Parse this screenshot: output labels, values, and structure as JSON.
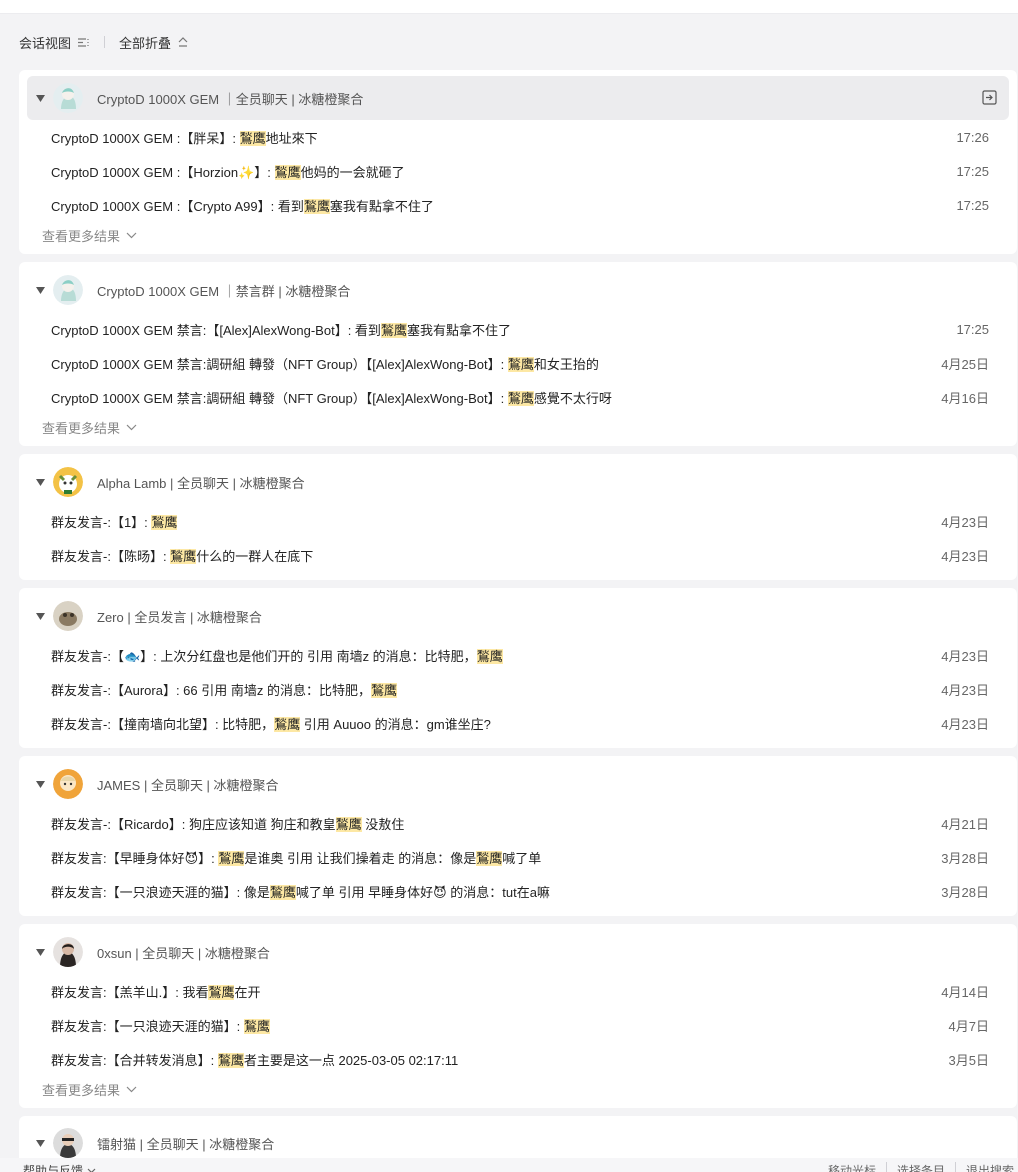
{
  "toolbar": {
    "view_label": "会话视图",
    "collapse_label": "全部折叠"
  },
  "groups": [
    {
      "title": "CryptoD 1000X GEM ｜全员聊天 | 冰糖橙聚合",
      "more_label": "查看更多结果",
      "messages": [
        {
          "pre": "CryptoD 1000X GEM :【胖呆】: ",
          "hl": "鶖鹰",
          "post": "地址來下",
          "time": "17:26"
        },
        {
          "pre": "CryptoD 1000X GEM :【Horzion✨】: ",
          "hl": "鶖鹰",
          "post": "他妈的一会就砸了",
          "time": "17:25"
        },
        {
          "pre": "CryptoD 1000X GEM :【Crypto A99】: 看到",
          "hl": "鶖鹰",
          "post": "塞我有點拿不住了",
          "time": "17:25"
        }
      ]
    },
    {
      "title": "CryptoD 1000X GEM ｜禁言群 | 冰糖橙聚合",
      "more_label": "查看更多结果",
      "messages": [
        {
          "pre": "CryptoD 1000X GEM 禁言:【[Alex]AlexWong-Bot】: 看到",
          "hl": "鶖鹰",
          "post": "塞我有點拿不住了",
          "time": "17:25"
        },
        {
          "pre": "CryptoD 1000X GEM 禁言:調研組 轉發（NFT Group）【[Alex]AlexWong-Bot】: ",
          "hl": "鶖鹰",
          "post": "和女王抬的",
          "time": "4月25日"
        },
        {
          "pre": "CryptoD 1000X GEM 禁言:調研組 轉發（NFT Group）【[Alex]AlexWong-Bot】: ",
          "hl": "鶖鹰",
          "post": "感覺不太行呀",
          "time": "4月16日"
        }
      ]
    },
    {
      "title": "Alpha Lamb | 全员聊天 | 冰糖橙聚合",
      "messages": [
        {
          "pre": "群友发言-:【1】:  ",
          "hl": "鶖鹰",
          "post": "",
          "time": "4月23日"
        },
        {
          "pre": "群友发言-:【陈旸】:  ",
          "hl": "鶖鹰",
          "post": "什么的一群人在底下",
          "time": "4月23日"
        }
      ]
    },
    {
      "title": "Zero | 全员发言 | 冰糖橙聚合",
      "messages": [
        {
          "pre": "群友发言-:【🐟】:  上次分红盘也是他们开的 引用 南墙z 的消息：比特肥，",
          "hl": "鶖鹰",
          "post": "",
          "time": "4月23日"
        },
        {
          "pre": "群友发言-:【Aurora】:  66 引用 南墙z 的消息：比特肥，",
          "hl": "鶖鹰",
          "post": "",
          "time": "4月23日"
        },
        {
          "pre": "群友发言-:【撞南墙向北望】:  比特肥，",
          "hl": "鶖鹰",
          "post": " 引用 Auuoo 的消息：gm谁坐庄?",
          "time": "4月23日"
        }
      ]
    },
    {
      "title": "JAMES | 全员聊天 | 冰糖橙聚合",
      "messages": [
        {
          "pre": "群友发言-:【Ricardo】:  狗庄应该知道 狗庄和教皇",
          "hl": "鶖鹰",
          "post": " 没敖住",
          "time": "4月21日"
        },
        {
          "pre": "群友发言:【早睡身体好😈】: ",
          "hl": "鶖鹰",
          "post": "是谁奥 引用 让我们操着走 的消息：像是",
          "hl2": "鶖鹰",
          "post2": "喊了单",
          "time": "3月28日"
        },
        {
          "pre": "群友发言:【一只浪迹天涯的猫】: 像是",
          "hl": "鶖鹰",
          "post": "喊了单 引用 早睡身体好😈 的消息：tut在a嘛",
          "time": "3月28日"
        }
      ]
    },
    {
      "title": "0xsun | 全员聊天 | 冰糖橙聚合",
      "more_label": "查看更多结果",
      "messages": [
        {
          "pre": "群友发言:【羔羊山.】:  我看",
          "hl": "鶖鹰",
          "post": "在开",
          "time": "4月14日"
        },
        {
          "pre": "群友发言:【一只浪迹天涯的猫】:  ",
          "hl": "鶖鹰",
          "post": "",
          "time": "4月7日"
        },
        {
          "pre": "群友发言:【合并转发消息】: ",
          "hl": "鶖鹰",
          "post": "者主要是这一点 2025-03-05 02:17:11",
          "time": "3月5日"
        }
      ]
    },
    {
      "title": "镭射猫 | 全员聊天 | 冰糖橙聚合",
      "messages": []
    }
  ],
  "footer": {
    "help_label": "帮助与反馈",
    "move_label": "移动光标",
    "select_label": "选择条目",
    "exit_label": "退出搜索"
  },
  "colors": {
    "highlight": "#fde8a4",
    "card": "#ffffff",
    "background": "#f3f3f5",
    "active_head": "#ececee"
  }
}
